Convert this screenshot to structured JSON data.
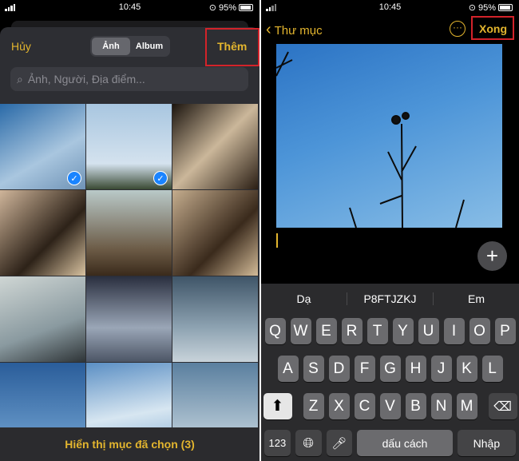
{
  "status": {
    "time": "10:45",
    "battery": "95%"
  },
  "left": {
    "cancel": "Hủy",
    "segments": [
      "Ảnh",
      "Album"
    ],
    "selected_segment": "Ảnh",
    "add": "Thêm",
    "search_placeholder": "Ảnh, Người, Địa điểm...",
    "photos": [
      {
        "selected": true
      },
      {
        "selected": true
      },
      {
        "selected": false
      },
      {
        "selected": false
      },
      {
        "selected": false
      },
      {
        "selected": false
      },
      {
        "selected": false
      },
      {
        "selected": false
      },
      {
        "selected": false
      },
      {
        "selected": false
      },
      {
        "selected": false
      },
      {
        "selected": false
      }
    ],
    "show_selected": "Hiển thị mục đã chọn (3)"
  },
  "right": {
    "back": "Thư mục",
    "done": "Xong",
    "suggestions": [
      "Dạ",
      "P8FTJZKJ",
      "Em"
    ],
    "rows": [
      [
        "Q",
        "W",
        "E",
        "R",
        "T",
        "Y",
        "U",
        "I",
        "O",
        "P"
      ],
      [
        "A",
        "S",
        "D",
        "F",
        "G",
        "H",
        "J",
        "K",
        "L"
      ],
      [
        "Z",
        "X",
        "C",
        "V",
        "B",
        "N",
        "M"
      ]
    ],
    "num_key": "123",
    "space": "dấu cách",
    "return": "Nhập"
  },
  "colors": {
    "accent": "#e3b52e",
    "highlight": "#d3232a",
    "check": "#1a84ff"
  }
}
